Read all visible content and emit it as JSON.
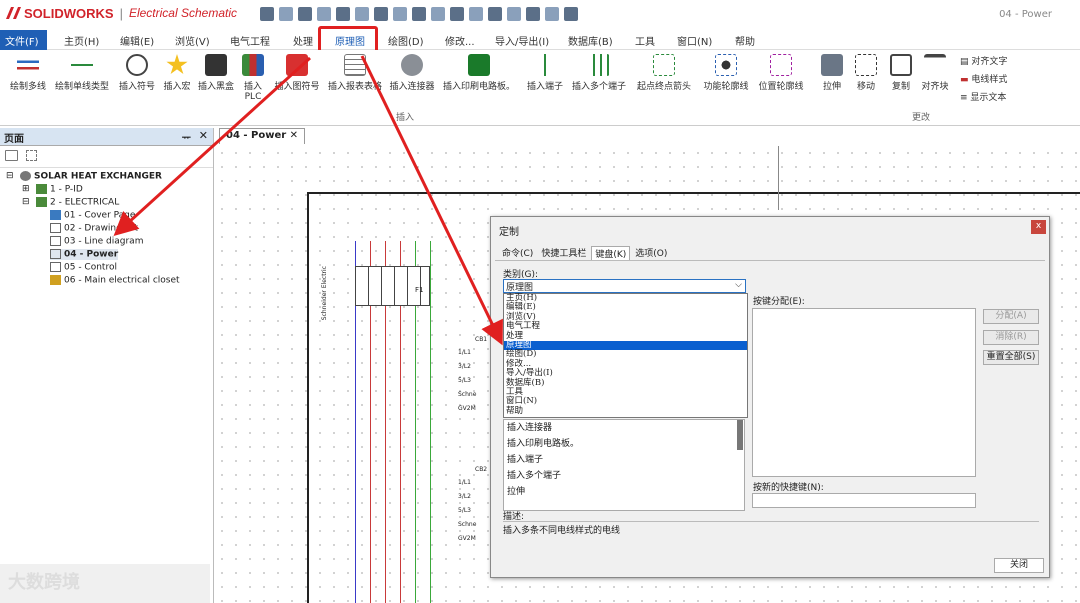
{
  "app": {
    "brand": "SOLIDWORKS",
    "product": "Electrical Schematic",
    "doc_title": "04 - Power"
  },
  "menu": {
    "file": "文件(F)",
    "items": [
      "主页(H)",
      "编辑(E)",
      "浏览(V)",
      "电气工程",
      "处理",
      "原理图",
      "绘图(D)",
      "修改...",
      "导入/导出(I)",
      "数据库(B)",
      "工具",
      "窗口(N)",
      "帮助"
    ]
  },
  "ribbon": {
    "buttons": [
      "绘制多线",
      "绘制单线类型",
      "插入符号",
      "插入宏",
      "插入黑盒",
      "插入PLC",
      "插入图符号",
      "插入报表表格",
      "插入连接器",
      "插入印刷电路板。",
      "插入端子",
      "插入多个端子",
      "起点终点箭头",
      "功能轮廓线",
      "位置轮廓线",
      "拉伸",
      "移动",
      "复制",
      "对齐块"
    ],
    "small": [
      "对齐文字",
      "电线样式",
      "显示文本"
    ],
    "group_insert": "插入",
    "group_edit": "更改"
  },
  "left_panel": {
    "title": "页面",
    "pin": "ᅲ",
    "close": "✕",
    "tree": {
      "project": "SOLAR HEAT EXCHANGER",
      "folder1": "1 - P-ID",
      "folder2": "2 - ELECTRICAL",
      "pages": [
        "01 - Cover Page",
        "02 - Drawing list",
        "03 - Line diagram",
        "04 - Power",
        "05 - Control",
        "06 - Main electrical closet"
      ]
    }
  },
  "doc_tab": {
    "label": "04 - Power",
    "close": "✕"
  },
  "watermark": "大数跨境",
  "dialog": {
    "title": "定制",
    "close": "x",
    "tabs": [
      "命令(C)",
      "快捷工具栏",
      "键盘(K)",
      "选项(O)"
    ],
    "category_label": "类别(G):",
    "category_value": "原理图",
    "category_options": [
      "主页(H)",
      "编辑(E)",
      "浏览(V)",
      "电气工程",
      "处理",
      "原理图",
      "绘图(D)",
      "修改...",
      "导入/导出(I)",
      "数据库(B)",
      "工具",
      "窗口(N)",
      "帮助"
    ],
    "commands": [
      "插入连接器",
      "插入印刷电路板。",
      "插入端子",
      "插入多个端子",
      "拉伸"
    ],
    "keys_label": "按键分配(E):",
    "newkey_label": "按新的快捷键(N):",
    "btn_assign": "分配(A)",
    "btn_remove": "消除(R)",
    "btn_reset": "重置全部(S)",
    "desc_label": "描述:",
    "description": "插入多条不同电线样式的电线",
    "btn_close": "关闭"
  },
  "schematic": {
    "cb1": "CB1",
    "cb2": "CB2",
    "labels": [
      "1/L1",
      "3/L2",
      "5/L3",
      "Schne",
      "GV2M"
    ],
    "f1": "F1",
    "side": "Schneider Electric"
  },
  "colors": {
    "accent": "#1f5fb5",
    "highlight_box": "#e02020",
    "selection": "#0a5fcf"
  }
}
